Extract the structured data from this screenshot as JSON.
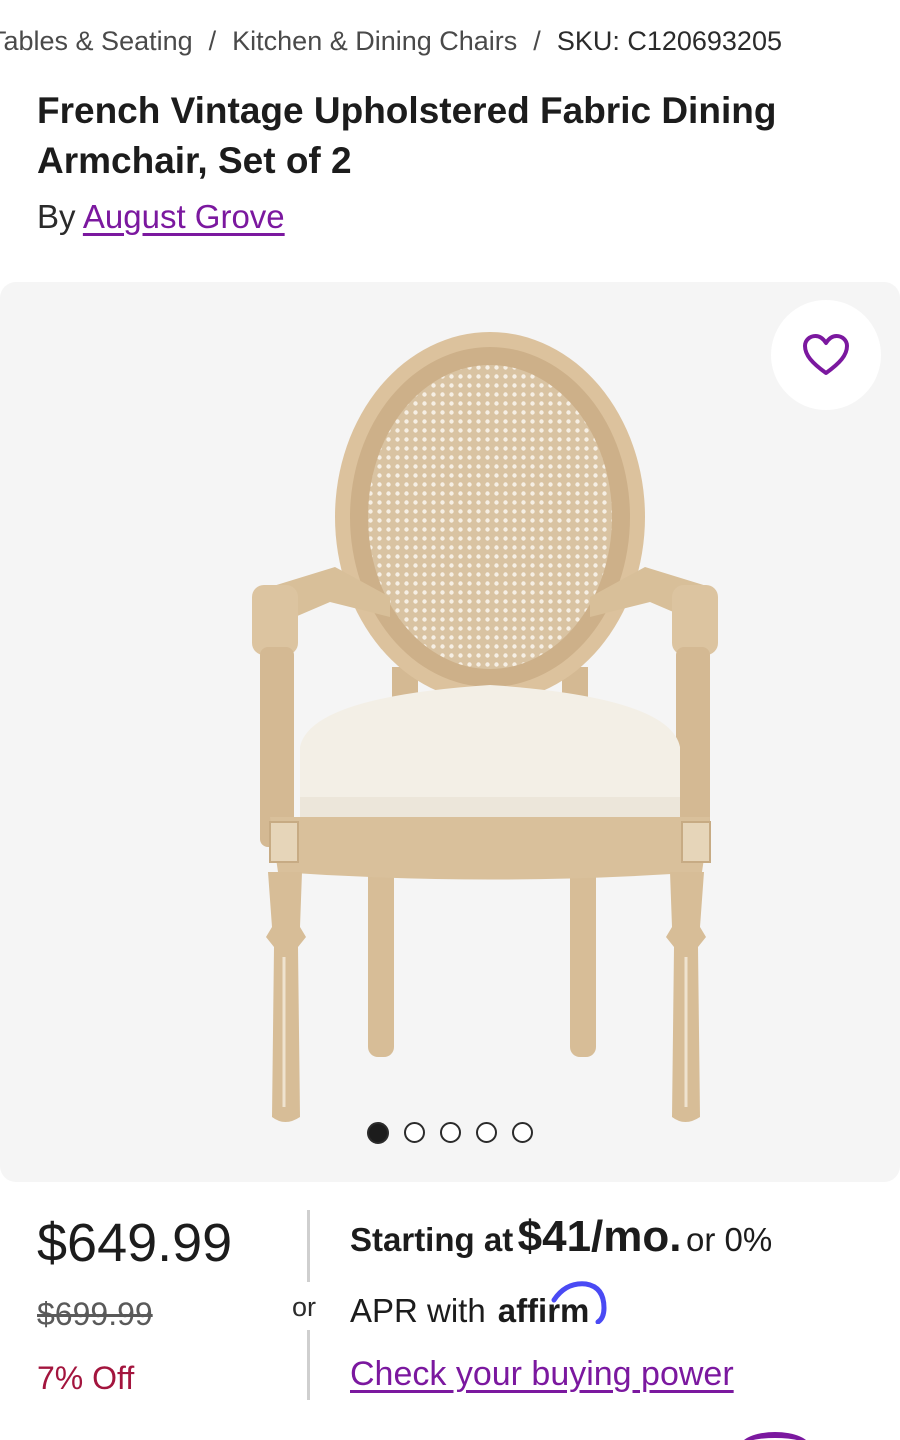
{
  "breadcrumb": {
    "items": [
      "Tables & Seating",
      "Kitchen & Dining Chairs"
    ],
    "separator": "/",
    "sku": "SKU: C120693205"
  },
  "product": {
    "title": "French Vintage Upholstered Fabric Dining Armchair, Set of 2",
    "by_label": "By",
    "brand": "August Grove"
  },
  "gallery": {
    "image_count": 5,
    "active_index": 0,
    "favorite_icon": "heart-outline-icon"
  },
  "pricing": {
    "price": "$649.99",
    "original_price": "$699.99",
    "discount": "7% Off"
  },
  "financing": {
    "or_label": "or",
    "starting_at": "Starting at",
    "monthly_amount": "$41/mo.",
    "or_zero": "or 0%",
    "apr_with": "APR with",
    "provider": "affirm",
    "link_label": "Check your buying power"
  },
  "colors": {
    "brand_purple": "#7b189f",
    "discount_red": "#a3153e",
    "affirm_blue": "#4a4af4"
  }
}
